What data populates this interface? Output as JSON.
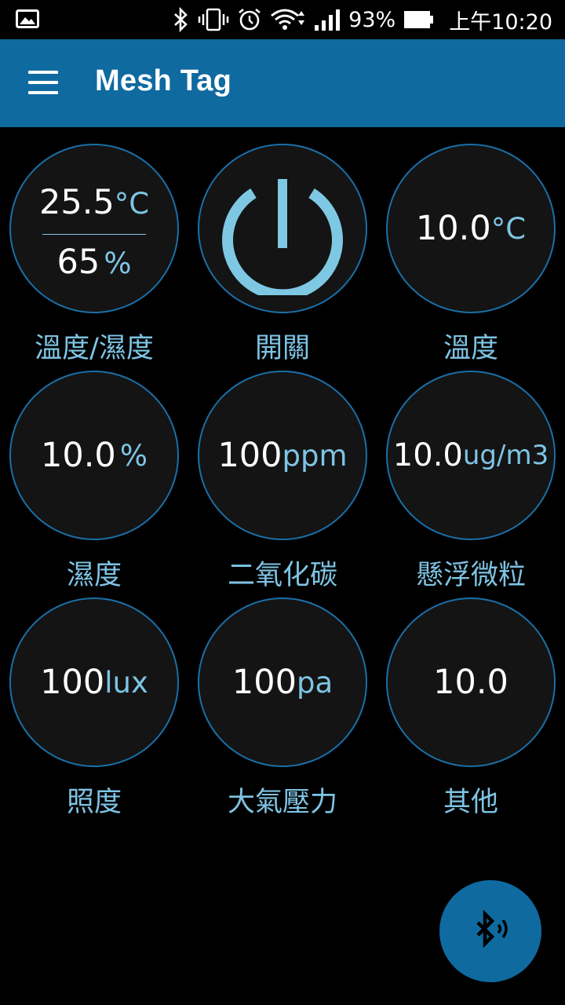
{
  "status_bar": {
    "battery_percent": "93%",
    "time": "上午10:20",
    "icons": [
      "image-icon",
      "bluetooth-icon",
      "vibrate-icon",
      "alarm-icon",
      "wifi-icon",
      "signal-icon",
      "battery-icon"
    ]
  },
  "app_bar": {
    "title": "Mesh Tag",
    "menu_icon": "hamburger-menu-icon",
    "background": "#0f6aa0"
  },
  "tiles": [
    {
      "id": "temp-humidity",
      "label": "溫度/濕度",
      "value1": "25.5",
      "unit1": "°C",
      "value2": "65",
      "unit2": "%"
    },
    {
      "id": "switch",
      "label": "開關",
      "icon": "power-icon"
    },
    {
      "id": "temperature",
      "label": "溫度",
      "value": "10.0",
      "unit": "°C"
    },
    {
      "id": "humidity",
      "label": "濕度",
      "value": "10.0",
      "unit": "%"
    },
    {
      "id": "co2",
      "label": "二氧化碳",
      "value": "100",
      "unit": "ppm"
    },
    {
      "id": "pm",
      "label": "懸浮微粒",
      "value": "10.0",
      "unit": "ug/m3"
    },
    {
      "id": "illuminance",
      "label": "照度",
      "value": "100",
      "unit": "lux"
    },
    {
      "id": "pressure",
      "label": "大氣壓力",
      "value": "100",
      "unit": "pa"
    },
    {
      "id": "other",
      "label": "其他",
      "value": "10.0",
      "unit": ""
    }
  ],
  "fab": {
    "icon": "bluetooth-searching-icon"
  },
  "colors": {
    "accent": "#7ec4e4",
    "circle_border": "#1a6fa8",
    "power": "#7ec8e3"
  }
}
